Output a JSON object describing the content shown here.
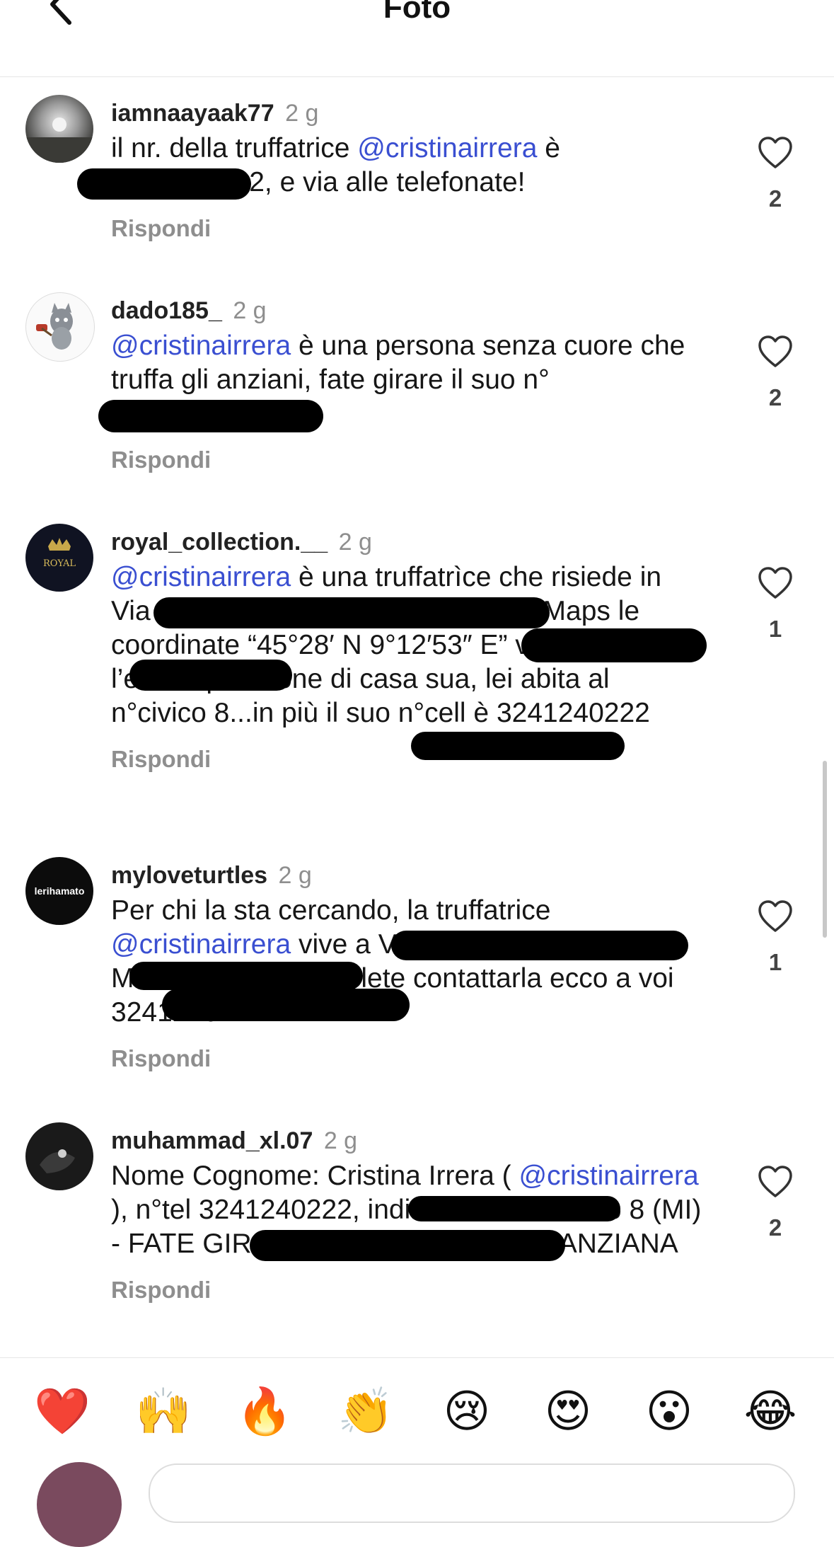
{
  "header": {
    "title": "Foto"
  },
  "comments": [
    {
      "username": "iamnaayaak77",
      "time": "2 g",
      "text": {
        "pre": "il nr. della truffatrice ",
        "mention": "@cristinairrera",
        "post": " è 3241240222, e via alle telefonate!"
      },
      "reply_label": "Rispondi",
      "likes": "2",
      "liked": false
    },
    {
      "username": "dado185_",
      "time": "2 g",
      "text": {
        "pre": "",
        "mention": "@cristinairrera",
        "post": " è una persona senza cuore che truffa gli anziani, fate girare il suo n° 3241240222"
      },
      "reply_label": "Rispondi",
      "likes": "2",
      "liked": false
    },
    {
      "username": "royal_collection.__",
      "time": "2 g",
      "text": {
        "pre": "",
        "mention": "@cristinairrera",
        "post": " è una truffatrìce che risiede in Via del Tiro (Milano), se cercate su Maps le coordinate “45°28′ N 9°12′53″ E” vi viene fuori l’esatta posizione di casa sua, lei abita al n°civico 8...in più il suo n°cell è 3241240222"
      },
      "reply_label": "Rispondi",
      "likes": "1",
      "liked": false
    },
    {
      "username": "myloveturtles",
      "time": "2 g",
      "text": {
        "pre": "Per chi la sta cercando, la truffatrice ",
        "mention": "@cristinairrera",
        "post": " vive a Via del Tiro, Bovisio a Milano, se invece volete contattarla ecco a voi 3241240222"
      },
      "reply_label": "Rispondi",
      "likes": "1",
      "liked": false
    },
    {
      "username": "muhammad_xl.07",
      "time": "2 g",
      "text": {
        "pre": "Nome Cognome: Cristina Irrera ( ",
        "mention": "@cristinairrera",
        "post": " ), n°tel 3241240222, indirizzo: Via del Tiro 8 (MI) - FATE GIRARE, HA TRUFFAT0 UN’ANZIANA"
      },
      "reply_label": "Rispondi",
      "likes": "2",
      "liked": false
    }
  ],
  "avatars": [
    "sunset-photo",
    "cartoon-cat",
    "royal-crown-logo",
    "lerihamato-text",
    "dark-photo"
  ],
  "avatar_labels": {
    "royal": "ROYAL",
    "lerihamato": "lerihamato"
  },
  "reactions": [
    "❤️",
    "🙌",
    "🔥",
    "👏",
    "😢",
    "😍",
    "😮",
    "😂"
  ],
  "colors": {
    "mention": "#3a4fd1",
    "meta": "#8e8e8e",
    "text": "#161616"
  }
}
